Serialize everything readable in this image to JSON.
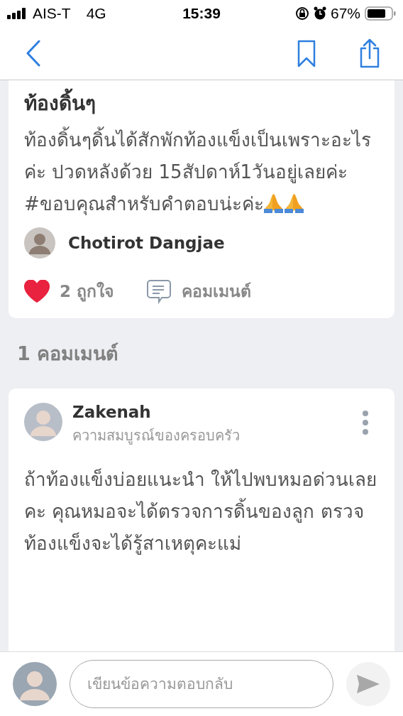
{
  "status_bar": {
    "carrier": "AIS-T",
    "network": "4G",
    "time": "15:39",
    "battery": "67%"
  },
  "post": {
    "title": "ท้องดิ้นๆ",
    "body": "ท้องดิ้นๆดิ้นได้สักพักท้องแข็งเป็นเพราะอะไรค่ะ ปวดหลังด้วย 15สัปดาห์1วันอยู่เลยค่ะ #ขอบคุณสำหรับคำตอบน่ะค่ะ",
    "author": "Chotirot Dangjae",
    "likes": "2 ถูกใจ",
    "liked": true,
    "comment_label": "คอมเมนต์"
  },
  "comments_heading": "1 คอมเมนต์",
  "comments": [
    {
      "author": "Zakenah",
      "subtitle": "ความสมบูรณ์ของครอบครัว",
      "body": "ถ้าท้องแข็งบ่อยแนะนำ ให้ไปพบหมอด่วนเลยคะ  คุณหมอจะได้ตรวจการดิ้นของลูก ตรวจท้องแข็งจะได้รู้สาเหตุคะแม่"
    }
  ],
  "reply": {
    "placeholder": "เขียนข้อความตอบกลับ"
  }
}
